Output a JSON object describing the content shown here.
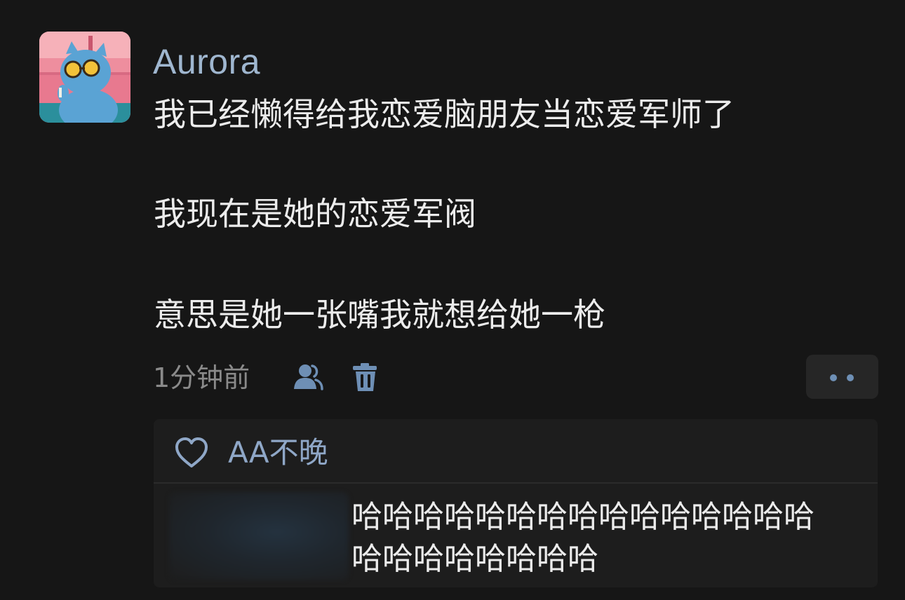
{
  "comment": {
    "author": "Aurora",
    "avatar": "cartoon-blue-cat-with-sunglasses",
    "message_lines": [
      "我已经懒得给我恋爱脑朋友当恋爱军师了",
      "我现在是她的恋爱军阀",
      "意思是她一张嘴我就想给她一枪"
    ],
    "time": "1分钟前"
  },
  "actions": {
    "visibility_icon": "users-icon",
    "delete_icon": "trash-icon",
    "more_icon": "more-dots-icon"
  },
  "likes": {
    "icon": "heart-outline-icon",
    "names": "AA不晚"
  },
  "reply": {
    "lines": [
      "哈哈哈哈哈哈哈哈哈哈哈哈哈哈哈",
      "哈哈哈哈哈哈哈哈"
    ]
  },
  "colors": {
    "background": "#161616",
    "username": "#9fb6cf",
    "accent": "#6e8fb5",
    "text": "#ececec",
    "muted": "#8a8a8a"
  }
}
